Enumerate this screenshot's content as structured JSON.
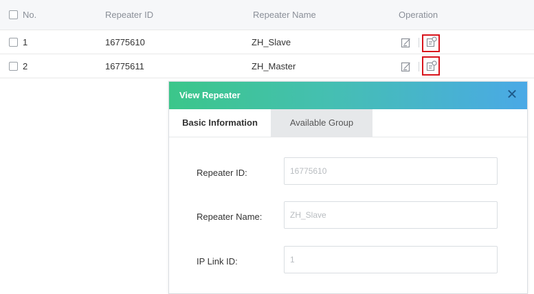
{
  "table": {
    "headers": {
      "no": "No.",
      "repeater_id": "Repeater ID",
      "repeater_name": "Repeater Name",
      "operation": "Operation"
    },
    "rows": [
      {
        "no": "1",
        "repeater_id": "16775610",
        "repeater_name": "ZH_Slave"
      },
      {
        "no": "2",
        "repeater_id": "16775611",
        "repeater_name": "ZH_Master"
      }
    ],
    "operation_icons": [
      "edit-icon",
      "view-details-icon"
    ]
  },
  "modal": {
    "title": "View Repeater",
    "close_symbol": "✕",
    "tabs": [
      {
        "label": "Basic Information",
        "active": true
      },
      {
        "label": "Available Group",
        "active": false
      }
    ],
    "fields": [
      {
        "label": "Repeater ID:",
        "value": "16775610"
      },
      {
        "label": "Repeater Name:",
        "value": "ZH_Slave"
      },
      {
        "label": "IP Link ID:",
        "value": "1"
      }
    ]
  },
  "colors": {
    "highlight": "#d8141c",
    "header_gradient_start": "#3bc68a",
    "header_gradient_end": "#4aa9e6",
    "close_icon": "#1e5a8a"
  }
}
